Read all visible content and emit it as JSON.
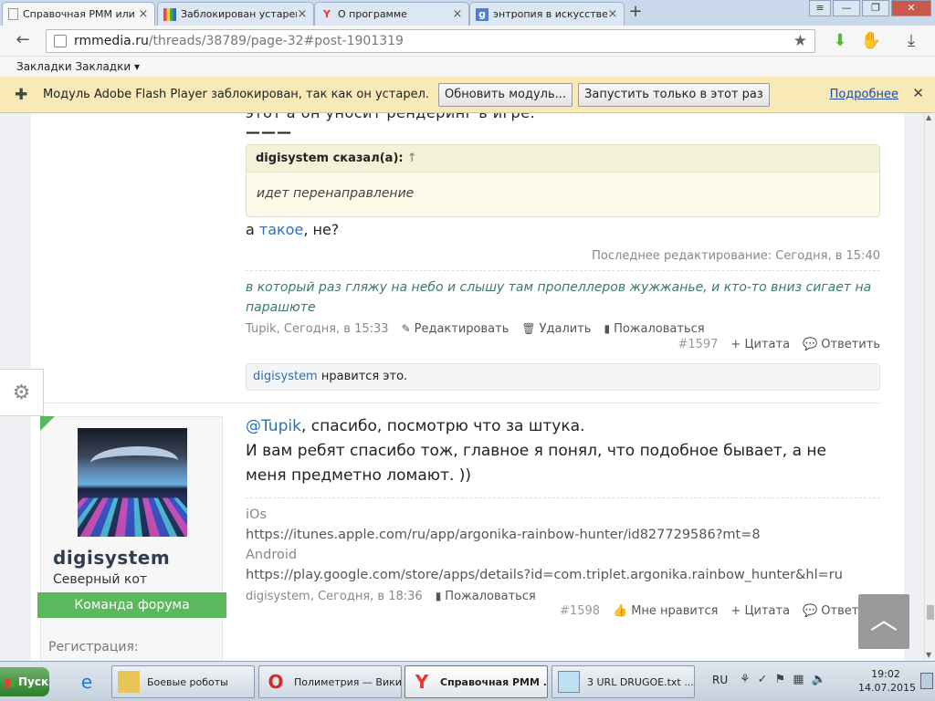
{
  "browser": {
    "tabs": [
      {
        "label": "Справочная РММ или Д",
        "icon": "page-icon",
        "active": true
      },
      {
        "label": "Заблокирован устаревш",
        "icon": "google-blocked-icon",
        "active": false
      },
      {
        "label": "О программе",
        "icon": "yandex-icon",
        "active": false
      },
      {
        "label": "энтропия в искусстве -",
        "icon": "google-icon",
        "active": false
      }
    ],
    "url_host": "rmmedia.ru",
    "url_path": "/threads/38789/page-32#post-1901319",
    "bookmarks_label": "Закладки Закладки ▾"
  },
  "infobar": {
    "message": "Модуль Adobe Flash Player заблокирован, так как он устарел.",
    "update_button": "Обновить модуль...",
    "run_once_button": "Запустить только в этот раз",
    "more_link": "Подробнее"
  },
  "post1": {
    "cut_text": "этот а он уносит рендеринг в игре.",
    "dashes": "———",
    "quote_author": "digisystem сказал(а):",
    "quote_arrow": "↑",
    "quote_text": "идет перенаправление",
    "reply_prefix": "а ",
    "reply_link": "такое",
    "reply_suffix": ", не?",
    "edited": "Последнее редактирование: Сегодня, в 15:40",
    "signature": "в который раз гляжу на небо и слышу там пропеллеров жужжанье, и кто-то вниз сигает на парашюте",
    "author_time": "Tupik, Сегодня, в 15:33",
    "edit_label": "Редактировать",
    "delete_label": "Удалить",
    "report_label": "Пожаловаться",
    "post_number": "#1597",
    "quote_label": "+ Цитата",
    "reply_label": "Ответить",
    "likes_user": "digisystem",
    "likes_text": " нравится это."
  },
  "post2": {
    "username": "digisystem",
    "user_title": "Северный кот",
    "badge": "Команда форума",
    "registration_label": "Регистрация:",
    "mention": "@Tupik",
    "line1": ", спасибо, посмотрю что за штука.",
    "line2": "И вам ребят спасибо тож, главное я понял, что подобное бывает, а не",
    "line3": "меня предметно ломают. ))",
    "sig_ios_label": "iOs",
    "sig_ios_url": "https://itunes.apple.com/ru/app/argonika-rainbow-hunter/id827729586?mt=8",
    "sig_android_label": "Android",
    "sig_android_url": "https://play.google.com/store/apps/details?id=com.triplet.argonika.rainbow_hunter&hl=ru",
    "author_time": "digisystem, Сегодня, в 18:36",
    "report_label": "Пожаловаться",
    "post_number": "#1598",
    "like_label": "Мне нравится",
    "quote_label": "+ Цитата",
    "reply_label": "Ответить"
  },
  "taskbar": {
    "start": "Пуск",
    "tasks": [
      {
        "label": "Боевые роботы",
        "icon": "folder-icon"
      },
      {
        "label": "Полиметрия — Вики...",
        "icon": "opera-icon"
      },
      {
        "label": "Справочная РММ ...",
        "icon": "yandex-browser-icon"
      },
      {
        "label": "3 URL DRUGOE.txt ...",
        "icon": "notepad-icon"
      }
    ],
    "lang": "RU",
    "time": "19:02",
    "date": "14.07.2015"
  },
  "colors": {
    "accent_green": "#5cb85c",
    "link_blue": "#2d70b3",
    "signature_green": "#3c7a6a",
    "infobar_yellow": "#f8e9b6"
  }
}
